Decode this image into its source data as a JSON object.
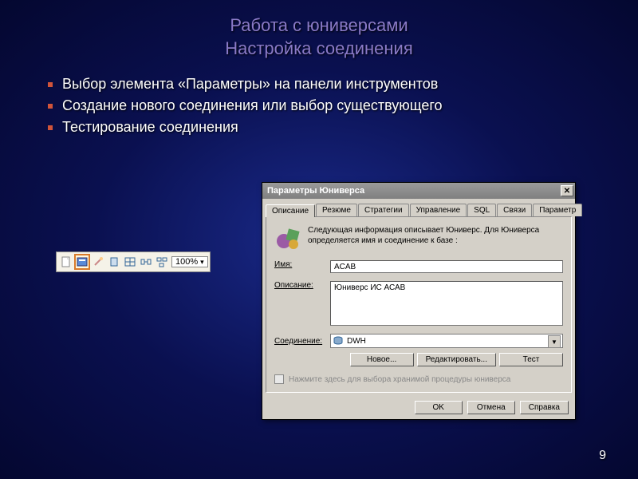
{
  "slide": {
    "title_line1": "Работа с юниверсами",
    "title_line2": "Настройка соединения",
    "bullets": [
      "Выбор элемента «Параметры» на панели инструментов",
      "Создание нового соединения или выбор существующего",
      "Тестирование соединения"
    ],
    "page_number": "9"
  },
  "toolbar": {
    "zoom": "100%"
  },
  "dialog": {
    "title": "Параметры Юниверса",
    "tabs": [
      "Описание",
      "Резюме",
      "Стратегии",
      "Управление",
      "SQL",
      "Связи",
      "Параметр"
    ],
    "info_text": "Следующая информация описывает Юниверс. Для Юниверса определяется имя и соединение к базе :",
    "fields": {
      "name_label": "Имя:",
      "name_value": "ACAB",
      "desc_label": "Описание:",
      "desc_value": "Юниверс ИС АСАВ",
      "conn_label": "Соединение:",
      "conn_value": "DWH"
    },
    "conn_buttons": {
      "new": "Новое...",
      "edit": "Редактировать...",
      "test": "Тест"
    },
    "checkbox_label": "Нажмите здесь для выбора хранимой процедуры юниверса",
    "buttons": {
      "ok": "OK",
      "cancel": "Отмена",
      "help": "Справка"
    }
  }
}
